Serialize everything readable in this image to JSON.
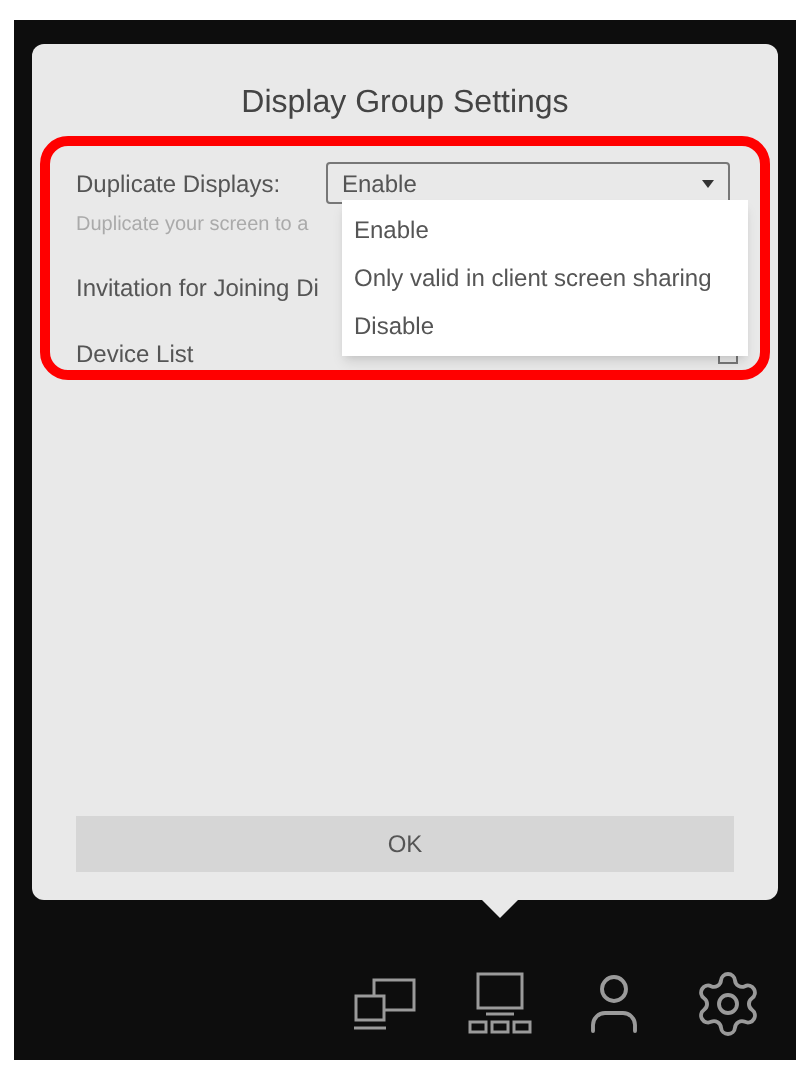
{
  "dialog": {
    "title": "Display Group Settings",
    "duplicate_displays": {
      "label": "Duplicate Displays:",
      "value": "Enable",
      "description": "Duplicate your screen to a",
      "expanded": true,
      "options": [
        {
          "label": "Enable"
        },
        {
          "label": "Only valid in client screen sharing"
        },
        {
          "label": "Disable"
        }
      ]
    },
    "invitation": {
      "label": "Invitation for Joining Di"
    },
    "device_list": {
      "label": "Device List",
      "select_all_checked": false
    },
    "ok_button": "OK"
  },
  "toolbar": {
    "items": [
      {
        "kind": "screens",
        "selected": false
      },
      {
        "kind": "group",
        "selected": true
      },
      {
        "kind": "user",
        "selected": false
      },
      {
        "kind": "settings",
        "selected": false
      }
    ]
  }
}
